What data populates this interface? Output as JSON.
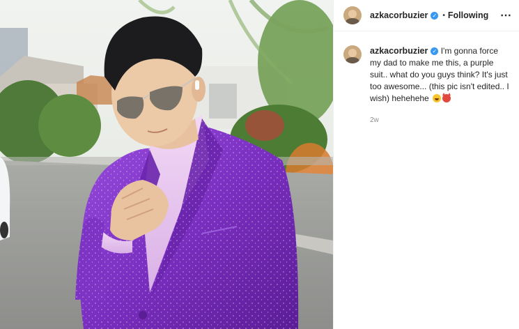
{
  "post": {
    "image": {
      "alt": "photo-purple-sparkle-suit"
    },
    "header": {
      "username": "azkacorbuzier",
      "verified_badge": "✓",
      "separator": "•",
      "follow_status": "Following",
      "more_icon": "⋯"
    },
    "caption": {
      "username": "azkacorbuzier",
      "verified_badge": "✓",
      "text": "I'm gonna force my dad to make me this, a purple suit.. what do you guys think? It's just too awesome... (this pic isn't edited.. I wish) hehehehe",
      "emojis": [
        "grinning-face-emoji",
        "smiling-devil-emoji"
      ],
      "timestamp": "2w"
    }
  },
  "colors": {
    "accent_verified": "#3897f0",
    "suit_purple": "#7a2fc0",
    "timestamp_gray": "#8e8e8e"
  }
}
